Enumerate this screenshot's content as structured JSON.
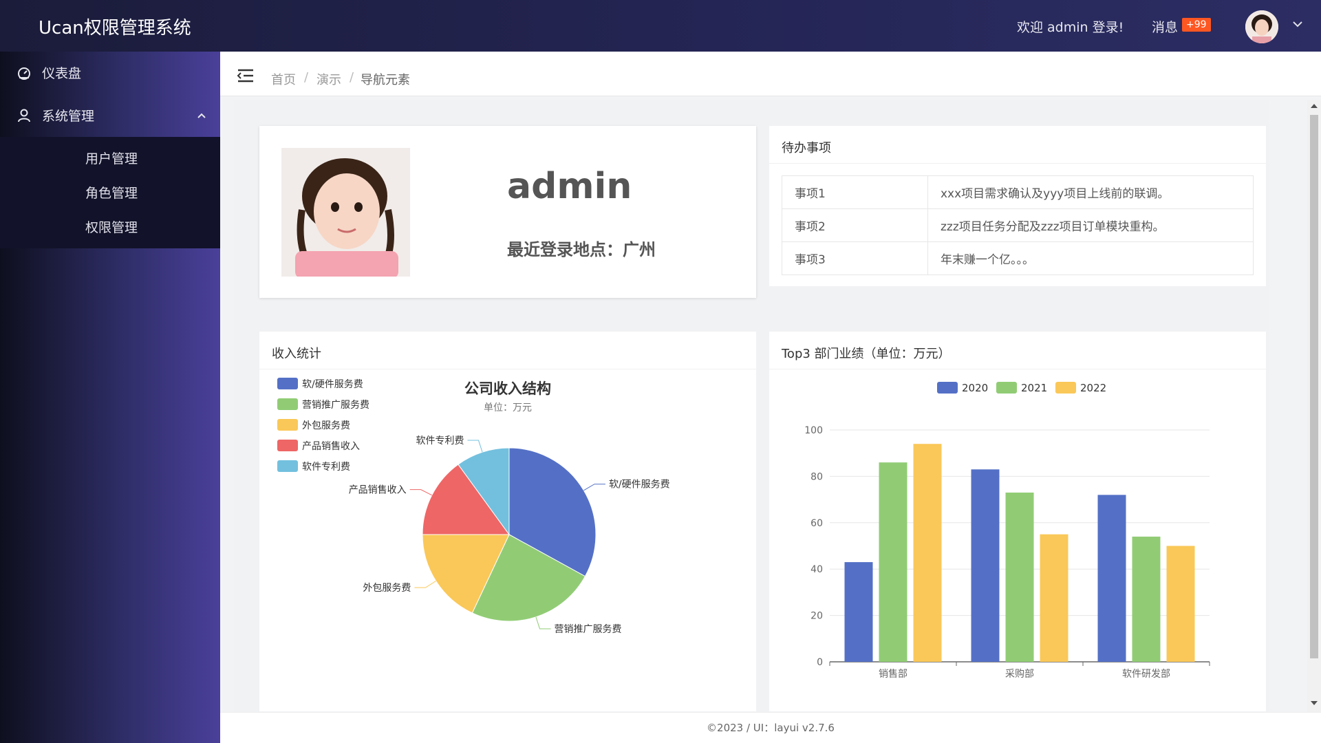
{
  "header": {
    "logo": "Ucan权限管理系统",
    "welcome": "欢迎 admin 登录!",
    "message_label": "消息",
    "message_badge": "+99"
  },
  "sidebar": {
    "items": [
      {
        "label": "仪表盘",
        "icon": "dashboard-icon"
      },
      {
        "label": "系统管理",
        "icon": "user-icon",
        "expanded": true,
        "children": [
          {
            "label": "用户管理"
          },
          {
            "label": "角色管理"
          },
          {
            "label": "权限管理"
          }
        ]
      }
    ]
  },
  "breadcrumb": [
    "首页",
    "演示",
    "导航元素"
  ],
  "profile": {
    "name": "admin",
    "last_login": "最近登录地点：广州"
  },
  "todo": {
    "title": "待办事项",
    "rows": [
      {
        "key": "事项1",
        "value": "xxx项目需求确认及yyy项目上线前的联调。"
      },
      {
        "key": "事项2",
        "value": "zzz项目任务分配及zzz项目订单模块重构。"
      },
      {
        "key": "事项3",
        "value": "年末赚一个亿。。。"
      }
    ]
  },
  "income": {
    "title": "收入统计"
  },
  "dept": {
    "title": "Top3 部门业绩（单位：万元）"
  },
  "footer": "©2023 / UI：layui v2.7.6",
  "chart_data": [
    {
      "type": "pie",
      "title": "公司收入结构",
      "subtitle": "单位：万元",
      "legend_position": "top-left",
      "slices": [
        {
          "name": "软/硬件服务费",
          "value": 33,
          "color": "#5470c6"
        },
        {
          "name": "营销推广服务费",
          "value": 24,
          "color": "#91cc75"
        },
        {
          "name": "外包服务费",
          "value": 18,
          "color": "#fac858"
        },
        {
          "name": "产品销售收入",
          "value": 15,
          "color": "#ee6666"
        },
        {
          "name": "软件专利费",
          "value": 10,
          "color": "#73c0de"
        }
      ]
    },
    {
      "type": "bar",
      "categories": [
        "销售部",
        "采购部",
        "软件研发部"
      ],
      "series": [
        {
          "name": "2020",
          "values": [
            43,
            83,
            72
          ],
          "color": "#5470c6"
        },
        {
          "name": "2021",
          "values": [
            86,
            73,
            54
          ],
          "color": "#91cc75"
        },
        {
          "name": "2022",
          "values": [
            94,
            55,
            50
          ],
          "color": "#fac858"
        }
      ],
      "ylim": [
        0,
        100
      ],
      "yticks": [
        0,
        20,
        40,
        60,
        80,
        100
      ],
      "legend_position": "top-center",
      "grid": true
    }
  ]
}
